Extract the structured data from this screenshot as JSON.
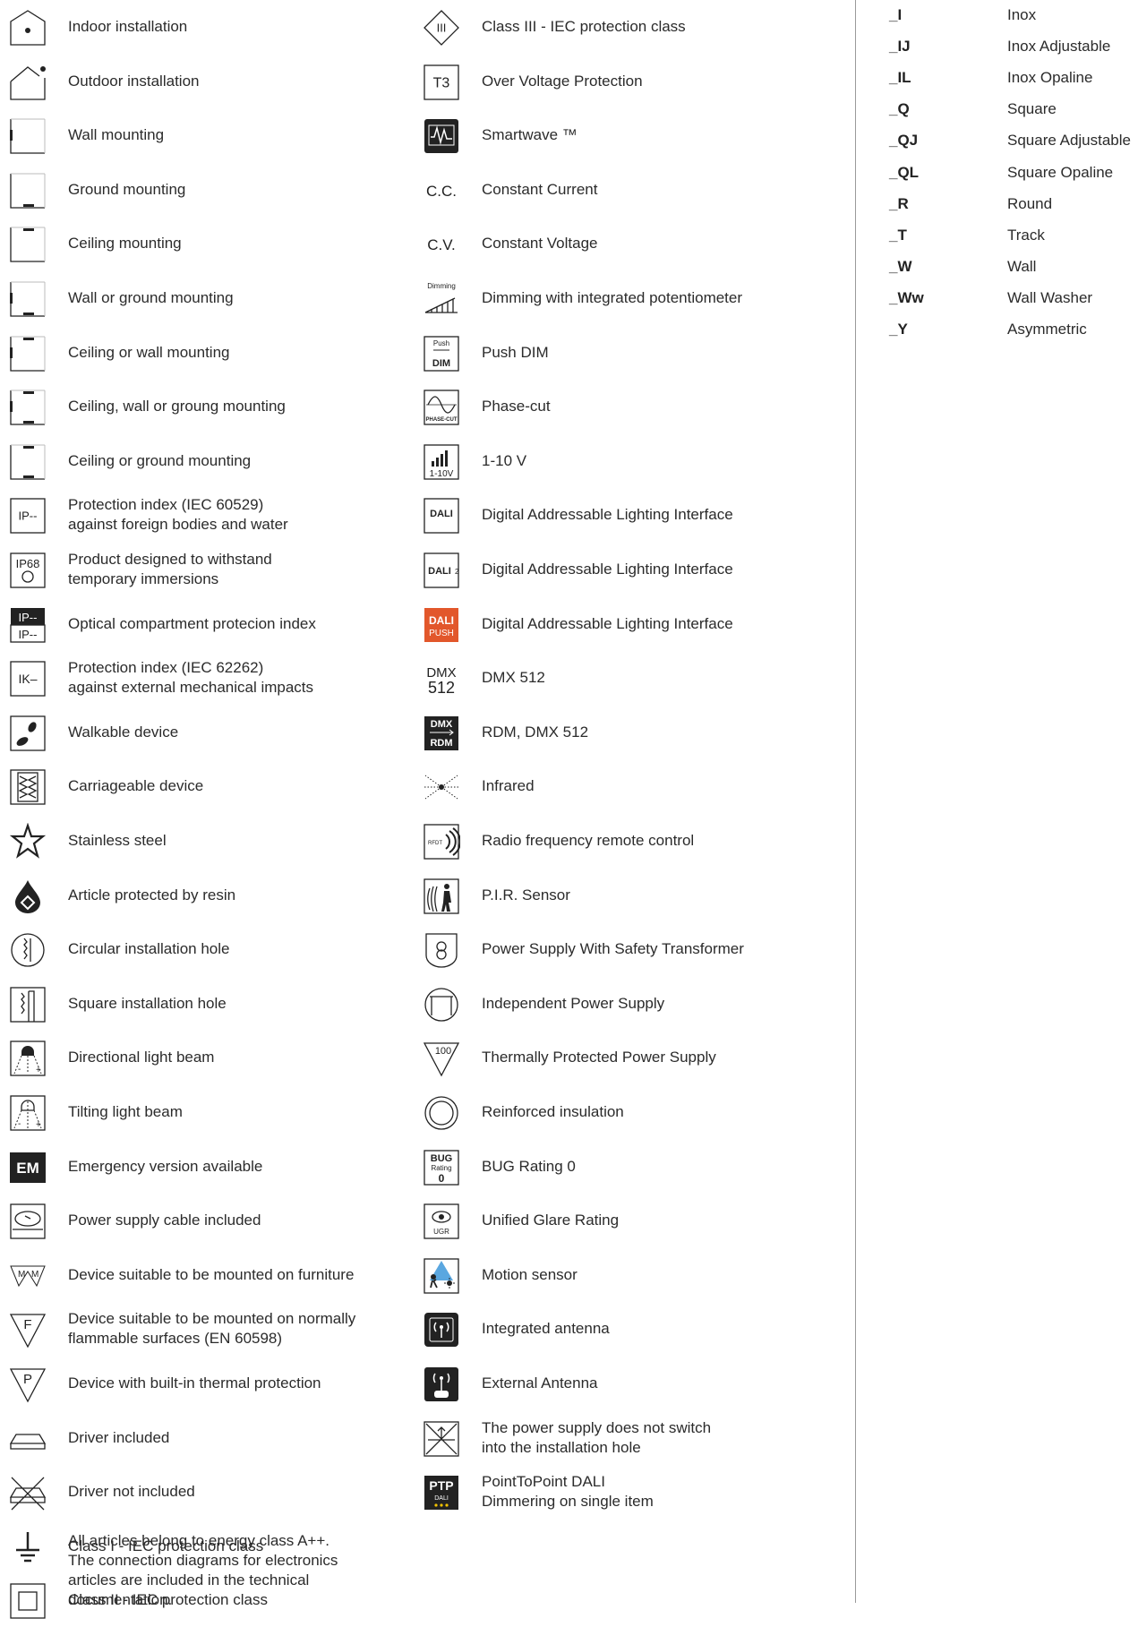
{
  "left_column": [
    {
      "icon": "indoor-installation-icon",
      "lines": [
        "Indoor installation"
      ]
    },
    {
      "icon": "outdoor-installation-icon",
      "lines": [
        "Outdoor installation"
      ]
    },
    {
      "icon": "wall-mounting-icon",
      "lines": [
        "Wall mounting"
      ]
    },
    {
      "icon": "ground-mounting-icon",
      "lines": [
        "Ground mounting"
      ]
    },
    {
      "icon": "ceiling-mounting-icon",
      "lines": [
        "Ceiling mounting"
      ]
    },
    {
      "icon": "wall-ground-mounting-icon",
      "lines": [
        "Wall or ground mounting"
      ]
    },
    {
      "icon": "ceiling-wall-mounting-icon",
      "lines": [
        "Ceiling or wall mounting"
      ]
    },
    {
      "icon": "ceiling-wall-ground-mounting-icon",
      "lines": [
        "Ceiling, wall or groung mounting"
      ]
    },
    {
      "icon": "ceiling-ground-mounting-icon",
      "lines": [
        "Ceiling or ground mounting"
      ]
    },
    {
      "icon": "ip-protection-icon",
      "icon_text": "IP--",
      "lines": [
        "Protection index (IEC 60529)",
        "against foreign bodies and water"
      ]
    },
    {
      "icon": "ip68-icon",
      "icon_text": "IP68",
      "lines": [
        "Product designed to withstand",
        "temporary immersions"
      ]
    },
    {
      "icon": "optical-compartment-ip-icon",
      "icon_text": "IP--",
      "lines": [
        "Optical compartment protecion index"
      ]
    },
    {
      "icon": "ik-protection-icon",
      "icon_text": "IK–",
      "lines": [
        "Protection index  (IEC 62262)",
        "against external mechanical impacts"
      ]
    },
    {
      "icon": "walkable-icon",
      "lines": [
        "Walkable device"
      ]
    },
    {
      "icon": "carriageable-icon",
      "lines": [
        "Carriageable device"
      ]
    },
    {
      "icon": "stainless-steel-icon",
      "lines": [
        "Stainless steel"
      ]
    },
    {
      "icon": "resin-drop-icon",
      "lines": [
        "Article protected by resin"
      ]
    },
    {
      "icon": "circular-hole-icon",
      "lines": [
        "Circular installation hole"
      ]
    },
    {
      "icon": "square-hole-icon",
      "lines": [
        "Square installation hole"
      ]
    },
    {
      "icon": "directional-beam-icon",
      "lines": [
        "Directional light beam"
      ]
    },
    {
      "icon": "tilting-beam-icon",
      "lines": [
        "Tilting light beam"
      ]
    },
    {
      "icon": "emergency-icon",
      "icon_text": "EM",
      "lines": [
        "Emergency version available"
      ]
    },
    {
      "icon": "power-cable-icon",
      "lines": [
        "Power supply cable included"
      ]
    },
    {
      "icon": "furniture-mount-icon",
      "icon_text": "M M",
      "lines": [
        "Device suitable to be mounted on furniture"
      ]
    },
    {
      "icon": "flammable-surface-icon",
      "icon_text": "F",
      "lines": [
        "Device suitable to be mounted on normally",
        "flammable surfaces (EN 60598)"
      ]
    },
    {
      "icon": "thermal-protection-icon",
      "icon_text": "P",
      "lines": [
        "Device with built-in thermal protection"
      ]
    },
    {
      "icon": "driver-included-icon",
      "lines": [
        "Driver included"
      ]
    },
    {
      "icon": "driver-not-included-icon",
      "lines": [
        "Driver not included"
      ]
    },
    {
      "icon": "class-i-earth-icon",
      "lines": [
        "Class I - IEC protection class"
      ]
    },
    {
      "icon": "class-ii-square-icon",
      "lines": [
        "Class II - IEC protection class"
      ]
    }
  ],
  "middle_column": [
    {
      "icon": "class-iii-icon",
      "icon_text": "III",
      "lines": [
        "Class III - IEC protection class"
      ]
    },
    {
      "icon": "over-voltage-icon",
      "icon_text": "T3",
      "lines": [
        "Over Voltage Protection"
      ]
    },
    {
      "icon": "smartwave-icon",
      "lines": [
        "Smartwave ™"
      ]
    },
    {
      "icon": "constant-current-icon",
      "icon_text": "C.C.",
      "lines": [
        "Constant Current"
      ]
    },
    {
      "icon": "constant-voltage-icon",
      "icon_text": "C.V.",
      "lines": [
        "Constant Voltage"
      ]
    },
    {
      "icon": "dimming-potentiometer-icon",
      "icon_text": "Dimming",
      "lines": [
        "Dimming with integrated potentiometer"
      ]
    },
    {
      "icon": "push-dim-icon",
      "icon_text": "Push DIM",
      "lines": [
        "Push DIM"
      ]
    },
    {
      "icon": "phase-cut-icon",
      "icon_text": "PHASE-CUT",
      "lines": [
        "Phase-cut"
      ]
    },
    {
      "icon": "1-10v-icon",
      "icon_text": "1-10V",
      "lines": [
        "1-10 V"
      ]
    },
    {
      "icon": "dali-icon",
      "icon_text": "DALI",
      "lines": [
        "Digital Addressable Lighting Interface"
      ]
    },
    {
      "icon": "dali2-icon",
      "icon_text": "DALI2",
      "lines": [
        "Digital Addressable Lighting Interface"
      ]
    },
    {
      "icon": "dali-push-icon",
      "icon_text": "DALI PUSH",
      "lines": [
        "Digital Addressable Lighting Interface"
      ]
    },
    {
      "icon": "dmx512-icon",
      "icon_text": "DMX 512",
      "lines": [
        "DMX 512"
      ]
    },
    {
      "icon": "rdm-dmx-icon",
      "icon_text": "DMX RDM",
      "lines": [
        "RDM, DMX 512"
      ]
    },
    {
      "icon": "infrared-icon",
      "lines": [
        "Infrared"
      ]
    },
    {
      "icon": "rf-remote-icon",
      "icon_text": "RFDT",
      "lines": [
        "Radio frequency remote control"
      ]
    },
    {
      "icon": "pir-sensor-icon",
      "lines": [
        "P.I.R. Sensor"
      ]
    },
    {
      "icon": "safety-transformer-icon",
      "lines": [
        "Power Supply With Safety Transformer"
      ]
    },
    {
      "icon": "independent-power-icon",
      "lines": [
        "Independent Power Supply"
      ]
    },
    {
      "icon": "thermally-protected-icon",
      "icon_text": "100",
      "lines": [
        "Thermally Protected Power Supply"
      ]
    },
    {
      "icon": "reinforced-insulation-icon",
      "lines": [
        "Reinforced insulation"
      ]
    },
    {
      "icon": "bug-rating-icon",
      "icon_text": "BUG Rating 0",
      "lines": [
        "BUG Rating 0"
      ]
    },
    {
      "icon": "ugr-icon",
      "icon_text": "UGR",
      "lines": [
        "Unified Glare Rating"
      ]
    },
    {
      "icon": "motion-sensor-icon",
      "lines": [
        "Motion sensor"
      ]
    },
    {
      "icon": "integrated-antenna-icon",
      "lines": [
        "Integrated antenna"
      ]
    },
    {
      "icon": "external-antenna-icon",
      "lines": [
        "External Antenna"
      ]
    },
    {
      "icon": "no-switch-hole-icon",
      "lines": [
        "The power supply does not switch",
        "into the installation hole"
      ]
    },
    {
      "icon": "ptp-dali-icon",
      "icon_text": "PTP DALI",
      "lines": [
        "PointToPoint DALI",
        "Dimmering on single item"
      ]
    }
  ],
  "note": [
    "All articles belong to energy class A++.",
    "The connection diagrams for electronics",
    "articles are included in the technical",
    "documentation."
  ],
  "codes": [
    {
      "code": "_I",
      "desc": "Inox"
    },
    {
      "code": "_IJ",
      "desc": "Inox Adjustable"
    },
    {
      "code": "_IL",
      "desc": "Inox Opaline"
    },
    {
      "code": "_Q",
      "desc": "Square"
    },
    {
      "code": "_QJ",
      "desc": "Square Adjustable"
    },
    {
      "code": "_QL",
      "desc": "Square Opaline"
    },
    {
      "code": "_R",
      "desc": "Round"
    },
    {
      "code": "_T",
      "desc": "Track"
    },
    {
      "code": "_W",
      "desc": "Wall"
    },
    {
      "code": "_Ww",
      "desc": "Wall Washer"
    },
    {
      "code": "_Y",
      "desc": "Asymmetric"
    }
  ],
  "colors": {
    "text": "#2b2b2b",
    "icon": "#222222",
    "dali_push": "#e2572b",
    "divider": "#9a9a9a"
  }
}
